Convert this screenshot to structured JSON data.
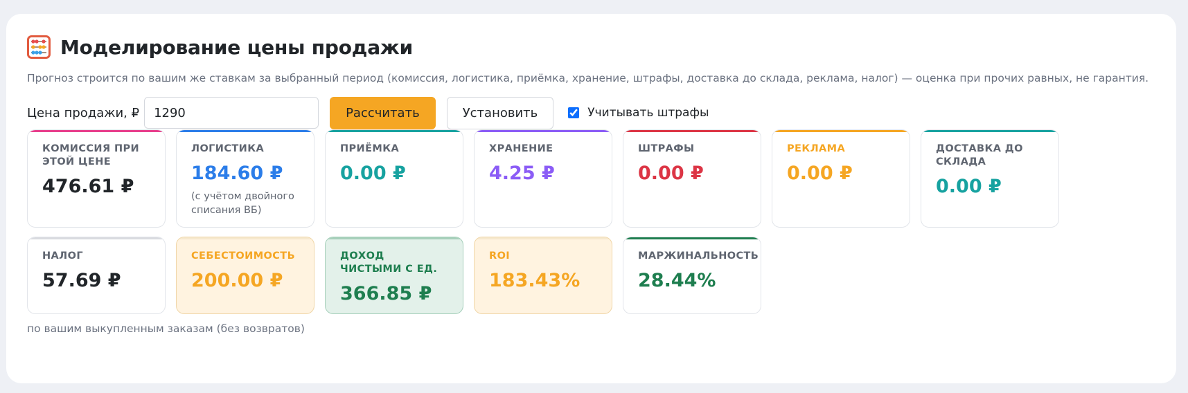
{
  "header": {
    "icon": "abacus-icon",
    "title": "Моделирование цены продажи",
    "description": "Прогноз строится по вашим же ставкам за выбранный период (комиссия, логистика, приёмка, хранение, штрафы, доставка до склада, реклама, налог) — оценка при прочих равных, не гарантия."
  },
  "controls": {
    "price_label": "Цена продажи, ₽",
    "price_value": "1290",
    "calc_label": "Рассчитать",
    "set_label": "Установить",
    "penalties_label": "Учитывать штрафы",
    "penalties_checked": true
  },
  "cards_row1": [
    {
      "title": "Комиссия при этой цене",
      "value": "476.61 ₽",
      "color": "#212529",
      "accent": "#e83e8c"
    },
    {
      "title": "Логистика",
      "value": "184.60 ₽",
      "note": "(с учётом двойного списания ВБ)",
      "color": "#2b7de9",
      "accent": "#2b7de9"
    },
    {
      "title": "Приёмка",
      "value": "0.00 ₽",
      "color": "#17a2a0",
      "accent": "#17a2a0"
    },
    {
      "title": "Хранение",
      "value": "4.25 ₽",
      "color": "#8b5cf6",
      "accent": "#8b5cf6"
    },
    {
      "title": "Штрафы",
      "value": "0.00 ₽",
      "color": "#dc3545",
      "accent": "#dc3545"
    },
    {
      "title": "Реклама",
      "value": "0.00 ₽",
      "color": "#f5a623",
      "accent": "#f5a623"
    },
    {
      "title": "Доставка до склада",
      "value": "0.00 ₽",
      "color": "#17a2a0",
      "accent": "#17a2a0"
    }
  ],
  "cards_row2": [
    {
      "title": "Налог",
      "value": "57.69 ₽",
      "color": "#212529",
      "accent": "#d9dbe0"
    },
    {
      "title": "Себестоимость",
      "value": "200.00 ₽",
      "color": "#f5a623",
      "accent": "#f6e8cd",
      "bg": "#fff3e0",
      "border": "#f0d6a8"
    },
    {
      "title": "Доход чистыми с ед.",
      "value": "366.85 ₽",
      "color": "#1e7e4f",
      "accent": "#a7d0bb",
      "bg": "#e3f1ea",
      "border": "#a7d0bb"
    },
    {
      "title": "ROI",
      "value": "183.43%",
      "color": "#f5a623",
      "accent": "#f6e8cd",
      "bg": "#fff3e0",
      "border": "#f0d6a8"
    },
    {
      "title": "Маржинальность",
      "value": "28.44%",
      "color": "#1e7e4f",
      "accent": "#1e7e4f"
    }
  ],
  "footnote": "по вашим выкупленным заказам (без возвратов)"
}
